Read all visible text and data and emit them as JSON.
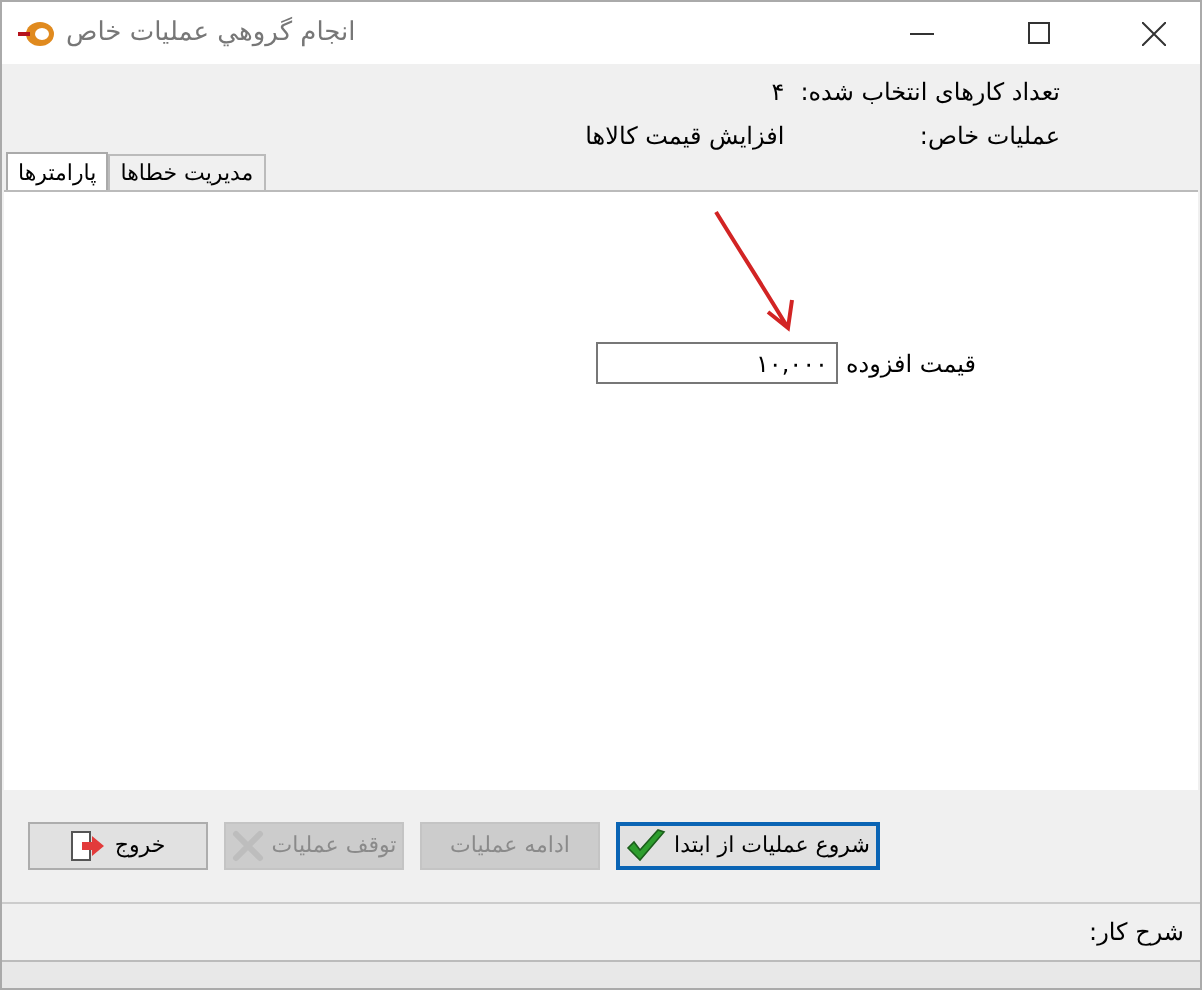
{
  "window": {
    "title": "انجام گروهي عمليات خاص"
  },
  "info": [
    {
      "label": "تعداد کارهای انتخاب شده:",
      "value": "۴"
    },
    {
      "label": "عملیات خاص:",
      "value": "افزایش قیمت کالاها"
    }
  ],
  "tabs": [
    {
      "label": "مدیریت خطاها",
      "selected": false
    },
    {
      "label": "پارامترها",
      "selected": true
    }
  ],
  "parameter": {
    "label": "قیمت افزوده",
    "value": "۱۰,۰۰۰"
  },
  "buttons": [
    {
      "label": "شروع عملیات از ابتدا",
      "kind": "check",
      "disabled": false,
      "default": true
    },
    {
      "label": "ادامه عملیات",
      "kind": "none",
      "disabled": true,
      "default": false
    },
    {
      "label": "توقف عملیات",
      "kind": "cross",
      "disabled": true,
      "default": false
    },
    {
      "label": "خروج",
      "kind": "exit",
      "disabled": false,
      "default": false
    }
  ],
  "status_bar": {
    "label": "شرح کار:"
  }
}
